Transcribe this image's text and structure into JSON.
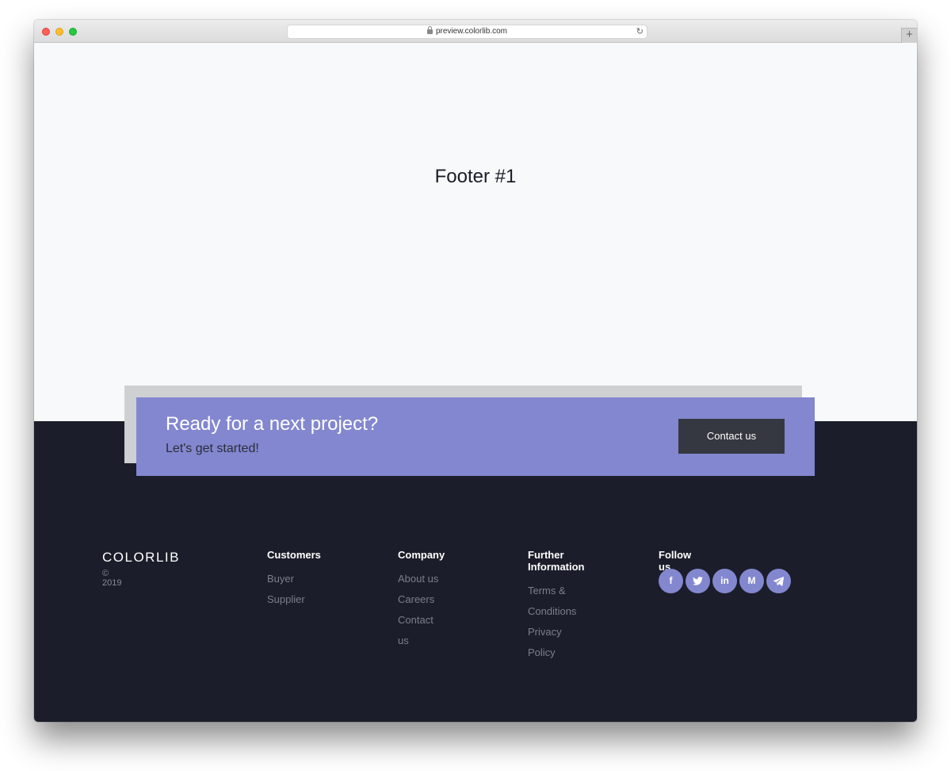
{
  "browser": {
    "url": "preview.colorlib.com"
  },
  "page": {
    "title": "Footer #1"
  },
  "cta": {
    "heading": "Ready for a next project?",
    "subtitle": "Let's get started!",
    "button_label": "Contact us"
  },
  "footer": {
    "brand": "COLORLIB",
    "copyright": "© 2019",
    "columns": [
      {
        "heading": "Customers",
        "links": [
          "Buyer",
          "Supplier"
        ]
      },
      {
        "heading": "Company",
        "links": [
          "About us",
          "Careers",
          "Contact us"
        ]
      },
      {
        "heading": "Further Information",
        "links": [
          "Terms & Conditions",
          "Privacy Policy"
        ]
      }
    ],
    "follow": {
      "heading": "Follow us",
      "icons": [
        "facebook-icon",
        "twitter-icon",
        "linkedin-icon",
        "medium-icon",
        "telegram-icon"
      ]
    }
  },
  "colors": {
    "accent": "#8387cf",
    "footer_bg": "#1b1e2a",
    "button_bg": "#353840",
    "page_bg": "#f8f9fb"
  }
}
